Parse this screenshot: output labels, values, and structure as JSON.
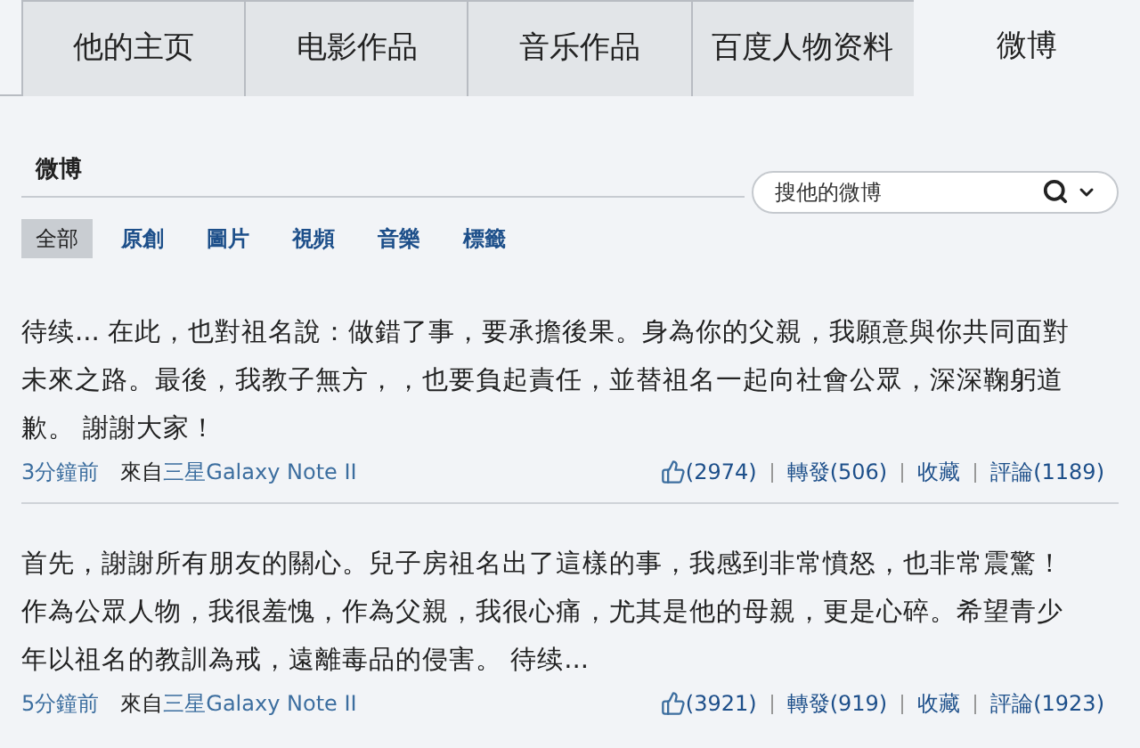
{
  "tabs": [
    {
      "label": "他的主页",
      "selected": false
    },
    {
      "label": "电影作品",
      "selected": false
    },
    {
      "label": "音乐作品",
      "selected": false
    },
    {
      "label": "百度人物资料",
      "selected": false
    },
    {
      "label": "微博",
      "selected": true
    }
  ],
  "section_title": "微博",
  "search": {
    "placeholder": "搜他的微博"
  },
  "filters": [
    {
      "label": "全部",
      "selected": true
    },
    {
      "label": "原創",
      "selected": false
    },
    {
      "label": "圖片",
      "selected": false
    },
    {
      "label": "視頻",
      "selected": false
    },
    {
      "label": "音樂",
      "selected": false
    },
    {
      "label": "標籤",
      "selected": false
    }
  ],
  "posts": [
    {
      "text": "待续... 在此，也對祖名說：做錯了事，要承擔後果。身為你的父親，我願意與你共同面對未來之路。最後，我教子無方，，也要負起責任，並替祖名一起向社會公眾，深深鞠躬道歉。 謝謝大家！",
      "time": "3分鐘前",
      "from_label": "來自",
      "source": "三星Galaxy Note II",
      "likes": "(2974)",
      "repost": "轉發(506)",
      "favorite": "收藏",
      "comment": "評論(1189)"
    },
    {
      "text": "首先，謝謝所有朋友的關心。兒子房祖名出了這樣的事，我感到非常憤怒，也非常震驚！作為公眾人物，我很羞愧，作為父親，我很心痛，尤其是他的母親，更是心碎。希望青少年以祖名的教訓為戒，遠離毒品的侵害。 待续...",
      "time": "5分鐘前",
      "from_label": "來自",
      "source": "三星Galaxy Note II",
      "likes": "(3921)",
      "repost": "轉發(919)",
      "favorite": "收藏",
      "comment": "評論(1923)"
    }
  ]
}
